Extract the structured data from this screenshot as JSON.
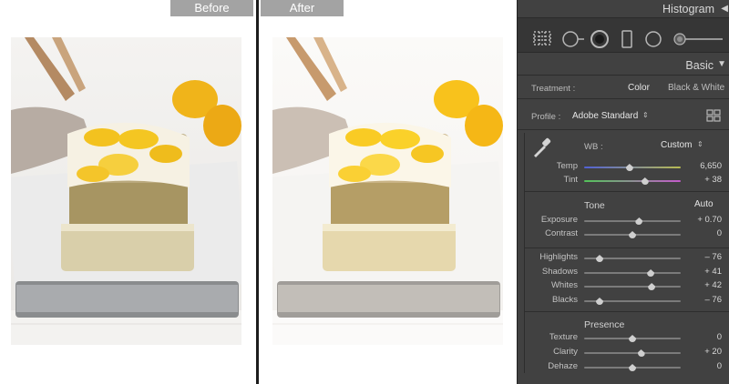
{
  "compare": {
    "before_label": "Before",
    "after_label": "After"
  },
  "panel": {
    "histogram_title": "Histogram",
    "basic_title": "Basic",
    "tools": [
      "crop-overlay-icon",
      "spot-removal-icon",
      "red-eye-icon",
      "graduated-filter-icon",
      "radial-filter-icon",
      "adjustment-brush-icon"
    ],
    "treatment": {
      "label": "Treatment :",
      "options": [
        "Color",
        "Black & White"
      ],
      "selected": "Color"
    },
    "profile": {
      "label": "Profile :",
      "value": "Adobe Standard",
      "browser_icon": "grid-icon"
    },
    "wb": {
      "label": "WB :",
      "value": "Custom",
      "eyedropper_icon": "eyedropper-icon"
    },
    "tone": {
      "title": "Tone",
      "auto_label": "Auto"
    },
    "presence": {
      "title": "Presence"
    },
    "sliders": [
      {
        "label": "Temp",
        "value": "6,650",
        "position": 0.47,
        "kind": "temp"
      },
      {
        "label": "Tint",
        "value": "+ 38",
        "position": 0.63,
        "kind": "tint"
      },
      {
        "label": "Exposure",
        "value": "+ 0.70",
        "position": 0.57,
        "kind": "normal"
      },
      {
        "label": "Contrast",
        "value": "0",
        "position": 0.5,
        "kind": "normal"
      },
      {
        "label": "Highlights",
        "value": "– 76",
        "position": 0.16,
        "kind": "normal"
      },
      {
        "label": "Shadows",
        "value": "+ 41",
        "position": 0.69,
        "kind": "normal"
      },
      {
        "label": "Whites",
        "value": "+ 42",
        "position": 0.7,
        "kind": "normal"
      },
      {
        "label": "Blacks",
        "value": "– 76",
        "position": 0.16,
        "kind": "normal"
      },
      {
        "label": "Texture",
        "value": "0",
        "position": 0.5,
        "kind": "normal"
      },
      {
        "label": "Clarity",
        "value": "+ 20",
        "position": 0.59,
        "kind": "normal"
      },
      {
        "label": "Dehaze",
        "value": "0",
        "position": 0.5,
        "kind": "normal"
      }
    ]
  },
  "colors": {
    "panel_bg": "#414141",
    "label_bar": "#a3a3a3",
    "lemon": "#f2b70f"
  }
}
